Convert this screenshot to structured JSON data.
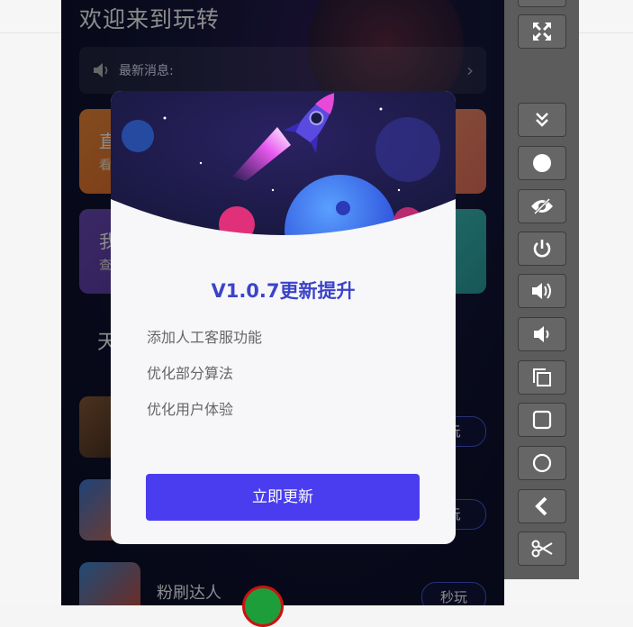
{
  "app": {
    "title": "欢迎来到玩转",
    "news_label": "最新消息:",
    "cards": [
      {
        "title": "直",
        "subtitle": "看"
      },
      {
        "title": "我",
        "subtitle": "查"
      }
    ],
    "section_title": "天",
    "games": [
      {
        "name": "",
        "play_label": "玩"
      },
      {
        "name": "",
        "play_label": "玩"
      },
      {
        "name": "粉刷达人",
        "play_label": "秒玩"
      }
    ]
  },
  "modal": {
    "version_title": "V1.0.7更新提升",
    "notes": [
      "添加人工客服功能",
      "优化部分算法",
      "优化用户体验"
    ],
    "update_button": "立即更新"
  },
  "toolbar": {
    "buttons": [
      "fullscreen-icon",
      "collapse-icon",
      "record-icon",
      "eye-icon",
      "power-icon",
      "volume-up-icon",
      "volume-down-icon",
      "rotate-icon",
      "home-square-icon",
      "circle-icon",
      "back-icon",
      "scissors-icon"
    ]
  },
  "colors": {
    "accent": "#4a3df0",
    "version_text": "#3b44c8",
    "toolbar_bg": "#5c5c5c"
  }
}
